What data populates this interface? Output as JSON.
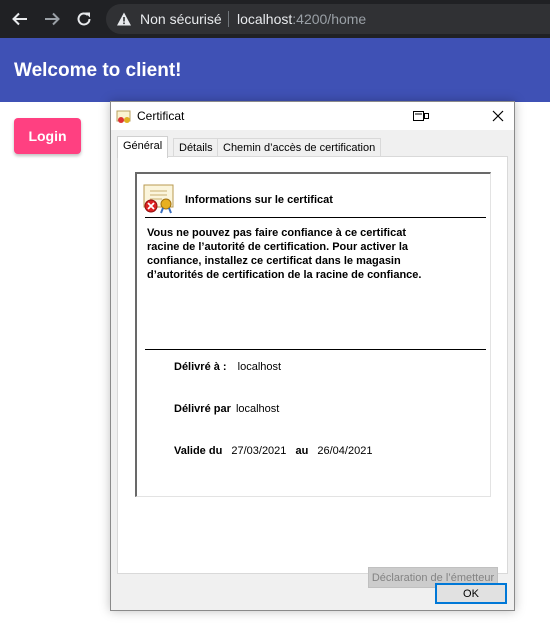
{
  "browser": {
    "security_label": "Non sécurisé",
    "url_host": "localhost",
    "url_rest": ":4200/home"
  },
  "app": {
    "title": "Welcome to client!",
    "login_label": "Login",
    "toolbar_color": "#3f51b5",
    "accent_color": "#ff4081"
  },
  "dialog": {
    "title": "Certificat",
    "tabs": [
      {
        "label": "Général",
        "active": true
      },
      {
        "label": "Détails",
        "active": false
      },
      {
        "label": "Chemin d’accès de certification",
        "active": false
      }
    ],
    "heading": "Informations sur le certificat",
    "message_lines": [
      "Vous ne pouvez pas faire confiance à ce certificat",
      "racine de l’autorité de certification. Pour activer la",
      "confiance, installez ce certificat dans le magasin",
      "d’autorités de certification de la racine de confiance."
    ],
    "issued_to_label": "Délivré à :",
    "issued_to_value": "localhost",
    "issued_by_label": "Délivré par",
    "issued_by_value": "localhost",
    "valid_from_label": "Valide du",
    "valid_from_value": "27/03/2021",
    "valid_to_label": "au",
    "valid_to_value": "26/04/2021",
    "issuer_statement_label": "Déclaration de l’émetteur",
    "ok_label": "OK"
  }
}
